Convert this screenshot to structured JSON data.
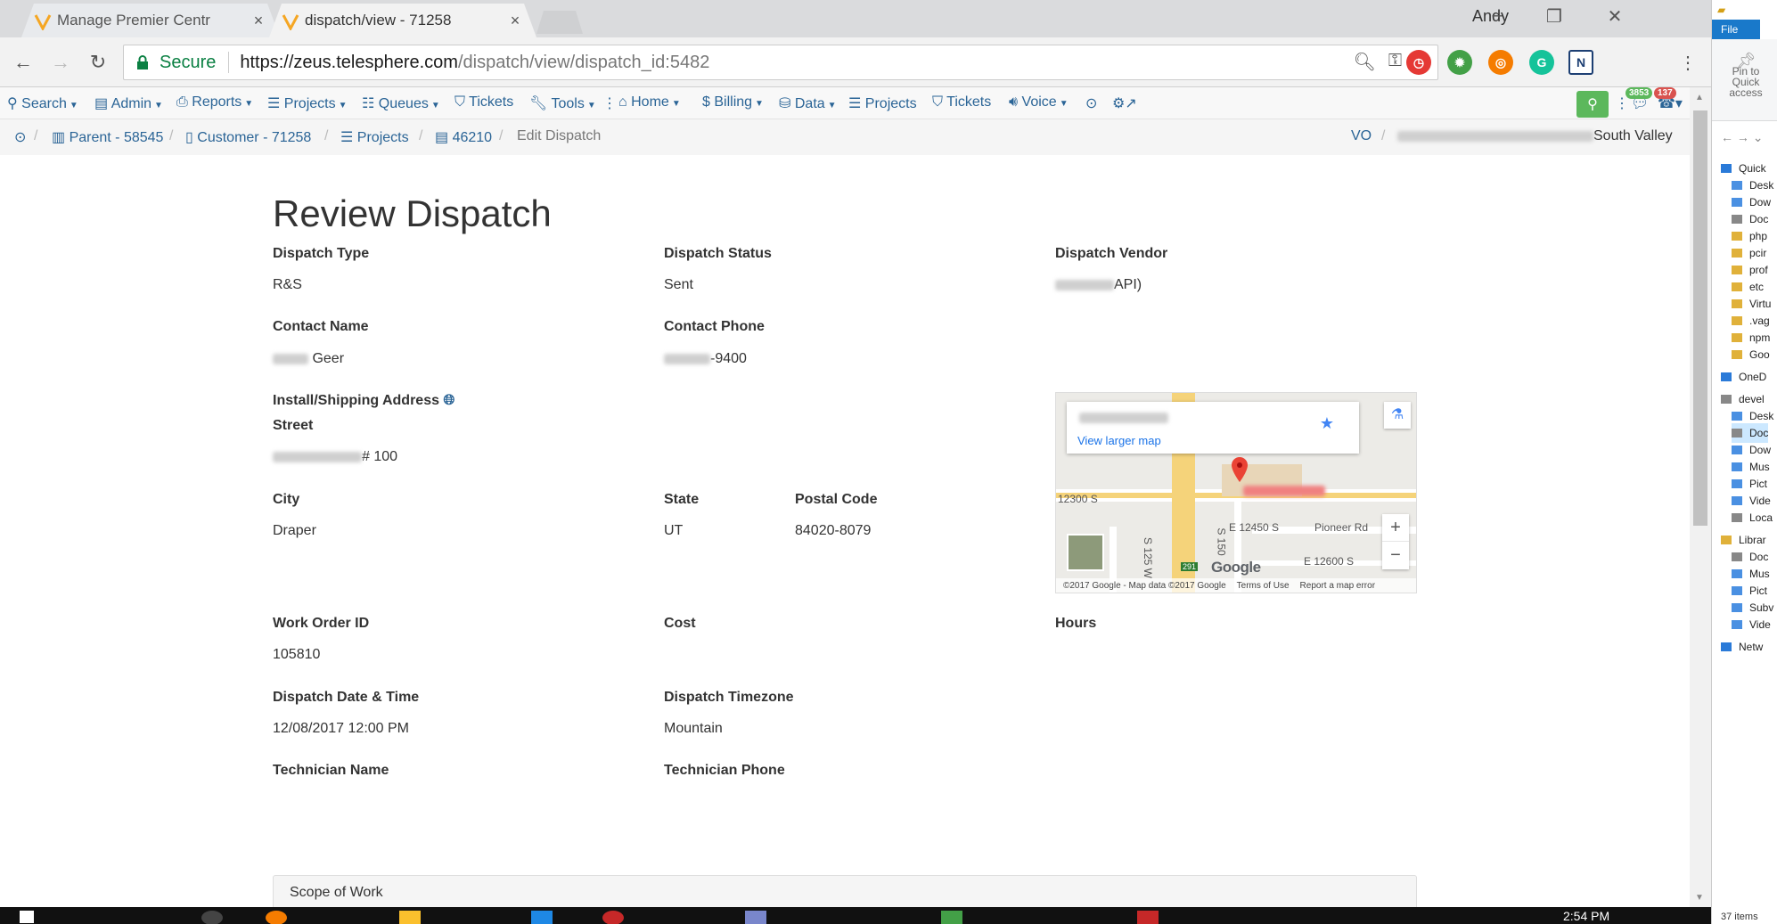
{
  "browser": {
    "tabs": [
      {
        "title": "Manage Premier Centr",
        "active": false
      },
      {
        "title": "dispatch/view - 71258",
        "active": true
      }
    ],
    "profile_name": "Andy",
    "secure_label": "Secure",
    "url_host": "https://zeus.telesphere.com",
    "url_path": "/dispatch/view/dispatch_id:5482"
  },
  "nav": {
    "items": [
      "Search",
      "Admin",
      "Reports",
      "Projects",
      "Queues",
      "Tickets",
      "Tools",
      "Home",
      "Billing",
      "Data",
      "Projects",
      "Tickets",
      "Voice"
    ],
    "badge_messages": "3853",
    "badge_alerts": "137"
  },
  "breadcrumb": {
    "items": [
      "Parent - 58545",
      "Customer - 71258",
      "Projects",
      "46210",
      "Edit Dispatch"
    ],
    "right_vo": "VO",
    "right_location_suffix": "South Valley"
  },
  "page": {
    "title": "Review Dispatch",
    "fields": {
      "dispatch_type_label": "Dispatch Type",
      "dispatch_type_value": "R&S",
      "dispatch_status_label": "Dispatch Status",
      "dispatch_status_value": "Sent",
      "dispatch_vendor_label": "Dispatch Vendor",
      "dispatch_vendor_value_suffix": "API)",
      "contact_name_label": "Contact Name",
      "contact_name_value_suffix": "Geer",
      "contact_phone_label": "Contact Phone",
      "contact_phone_value_suffix": "-9400",
      "address_label": "Install/Shipping Address",
      "street_label": "Street",
      "street_value_suffix": "# 100",
      "city_label": "City",
      "city_value": "Draper",
      "state_label": "State",
      "state_value": "UT",
      "postal_label": "Postal Code",
      "postal_value": "84020-8079",
      "work_order_label": "Work Order ID",
      "work_order_value": "105810",
      "cost_label": "Cost",
      "hours_label": "Hours",
      "date_label": "Dispatch Date & Time",
      "date_value": "12/08/2017 12:00 PM",
      "timezone_label": "Dispatch Timezone",
      "timezone_value": "Mountain",
      "tech_name_label": "Technician Name",
      "tech_phone_label": "Technician Phone"
    },
    "scope_title": "Scope of Work"
  },
  "map": {
    "view_larger": "View larger map",
    "street_labels": [
      "12300 S",
      "E 12450 S",
      "Pioneer Rd",
      "E 12600 S",
      "S 125 W",
      "S 150"
    ],
    "route_number": "291",
    "brand": "Google",
    "footer": [
      "©2017 Google - Map data ©2017 Google",
      "Terms of Use",
      "Report a map error"
    ],
    "zoom_in": "+",
    "zoom_out": "−"
  },
  "explorer": {
    "file_tab": "File",
    "pin_text": "Pin to Quick access",
    "tree": [
      "Quick",
      "Desk",
      "Dow",
      "Doc",
      "php",
      "pcir",
      "prof",
      "etc",
      "Virtu",
      ".vag",
      "npm",
      "Goo",
      "OneD",
      "devel",
      "Desk",
      "Doc",
      "Dow",
      "Mus",
      "Pict",
      "Vide",
      "Loca",
      "Librar",
      "Doc",
      "Mus",
      "Pict",
      "Subv",
      "Vide",
      "Netw"
    ],
    "status": "37 items"
  },
  "taskbar": {
    "clock": "2:54 PM"
  },
  "colors": {
    "link": "#2a6496",
    "green": "#5cb85c",
    "secure_green": "#0b8043",
    "map_road": "#f5d37a"
  }
}
